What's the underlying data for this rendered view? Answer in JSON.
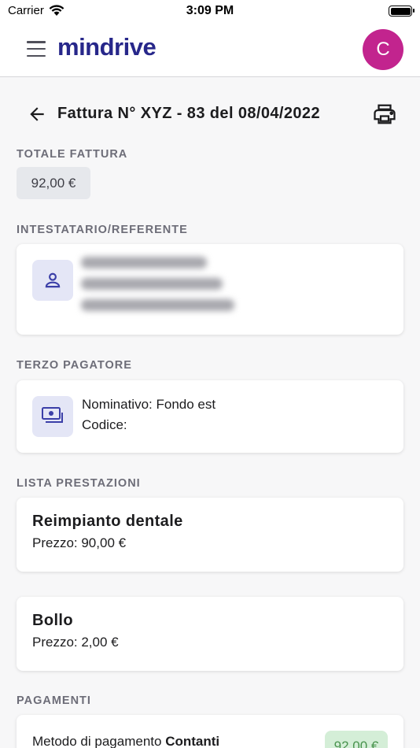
{
  "status_bar": {
    "carrier": "Carrier",
    "time": "3:09 PM"
  },
  "header": {
    "brand": "mindrive",
    "avatar_initial": "C"
  },
  "page": {
    "title": "Fattura N° XYZ - 83 del 08/04/2022"
  },
  "totale": {
    "label": "TOTALE FATTURA",
    "amount": "92,00 €"
  },
  "intestatario": {
    "label": "INTESTATARIO/REFERENTE"
  },
  "terzo_pagatore": {
    "label": "TERZO PAGATORE",
    "nominativo": "Nominativo: Fondo est",
    "codice": "Codice:"
  },
  "prestazioni": {
    "label": "LISTA PRESTAZIONI",
    "items": [
      {
        "name": "Reimpianto dentale",
        "price": "Prezzo: 90,00 €"
      },
      {
        "name": "Bollo",
        "price": "Prezzo: 2,00 €"
      }
    ]
  },
  "pagamenti": {
    "label": "PAGAMENTI",
    "method_prefix": "Metodo di pagamento",
    "method": "Contanti",
    "amount": "92,00 €"
  },
  "colors": {
    "brand": "#27278a",
    "avatar": "#c2248e",
    "icon_tint": "#3b3fa8",
    "paid_bg": "#d4eed7",
    "paid_text": "#4a944f"
  }
}
